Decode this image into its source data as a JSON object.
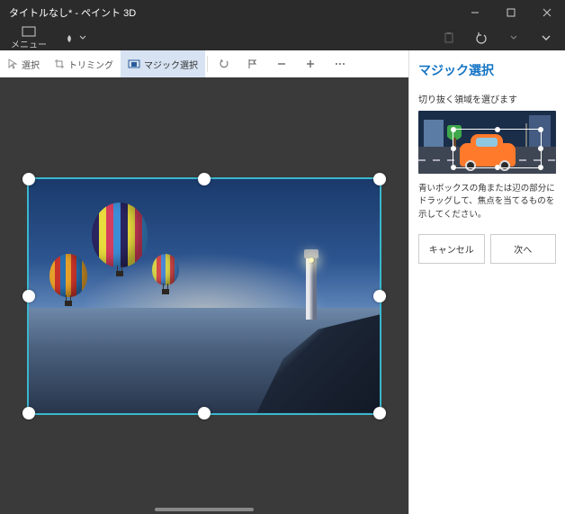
{
  "titlebar": {
    "title": "タイトルなし* - ペイント 3D"
  },
  "menubar": {
    "menu_label": "メニュー"
  },
  "toolbar": {
    "select": "選択",
    "trimming": "トリミング",
    "magic_select": "マジック選択"
  },
  "panel": {
    "title": "マジック選択",
    "subtitle": "切り抜く領域を選びます",
    "description": "青いボックスの角または辺の部分にドラッグして、焦点を当てるものを示してください。",
    "cancel": "キャンセル",
    "next": "次へ"
  }
}
